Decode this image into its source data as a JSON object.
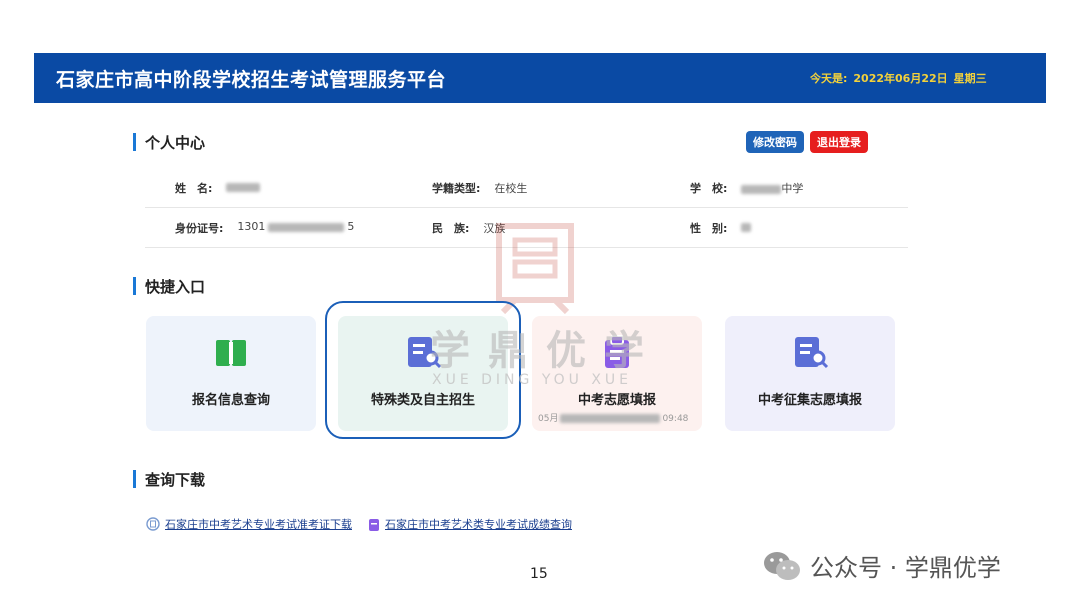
{
  "header": {
    "title": "石家庄市高中阶段学校招生考试管理服务平台",
    "date_prefix": "今天是:",
    "date": "2022年06月22日",
    "weekday": "星期三"
  },
  "personal": {
    "section_title": "个人中心",
    "change_password": "修改密码",
    "logout": "退出登录",
    "fields": {
      "name_label": "姓　名:",
      "status_label": "学籍类型:",
      "status_value": "在校生",
      "school_label": "学　校:",
      "school_suffix": "中学",
      "id_label": "身份证号:",
      "id_prefix": "1301",
      "id_suffix": "5",
      "ethnicity_label": "民　族:",
      "ethnicity_value": "汉族",
      "gender_label": "性　别:"
    }
  },
  "shortcuts": {
    "section_title": "快捷入口",
    "tiles": [
      {
        "label": "报名信息查询"
      },
      {
        "label": "特殊类及自主招生"
      },
      {
        "label": "中考志愿填报",
        "sub_prefix": "05月",
        "sub_suffix": "09:48"
      },
      {
        "label": "中考征集志愿填报"
      }
    ]
  },
  "downloads": {
    "section_title": "查询下载",
    "links": [
      "石家庄市中考艺术专业考试准考证下载",
      "石家庄市中考艺术类专业考试成绩查询"
    ]
  },
  "watermark": {
    "text": "学鼎优学",
    "pinyin": "XUE DING YOU XUE"
  },
  "page_number": "15",
  "wechat_label": "公众号 · 学鼎优学",
  "colors": {
    "header_bg": "#0a4aa4",
    "date_text": "#f2d13b",
    "primary_button": "#1f64b8",
    "danger_button": "#e61e1e",
    "accent_bar": "#1a78d6",
    "highlight_border": "#1b5fb8"
  }
}
